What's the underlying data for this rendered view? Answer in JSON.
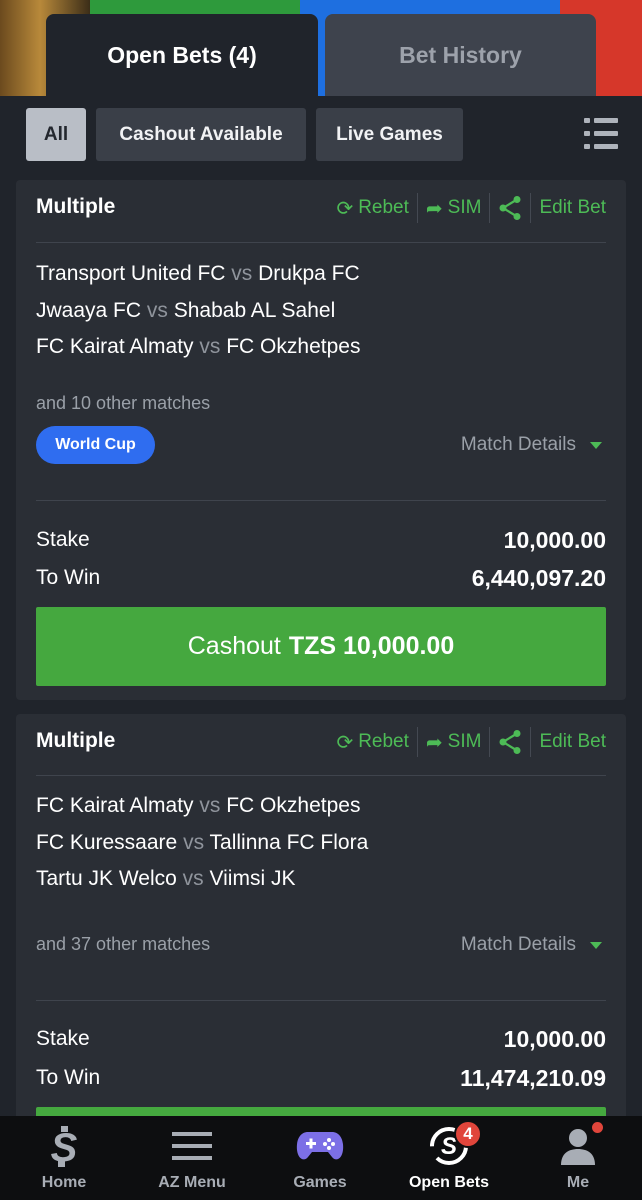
{
  "tabs": {
    "open_bets": "Open Bets (4)",
    "bet_history": "Bet History"
  },
  "filters": {
    "all": "All",
    "cashout_available": "Cashout Available",
    "live_games": "Live Games"
  },
  "colors": {
    "accent_green": "#4dbb56",
    "cashout_green": "#45a83f",
    "badge_blue": "#2f6df0",
    "notification_red": "#e0453b"
  },
  "bets": [
    {
      "type": "Multiple",
      "actions": {
        "rebet": "Rebet",
        "sim": "SIM",
        "edit": "Edit Bet"
      },
      "matches": [
        {
          "home": "Transport United FC",
          "vs": "vs",
          "away": "Drukpa FC"
        },
        {
          "home": "Jwaaya FC",
          "vs": "vs",
          "away": "Shabab AL Sahel"
        },
        {
          "home": "FC Kairat Almaty",
          "vs": "vs",
          "away": "FC Okzhetpes"
        }
      ],
      "more_matches": "and 10 other matches",
      "badge": "World Cup",
      "match_details": "Match Details",
      "stake_label": "Stake",
      "stake": "10,000.00",
      "to_win_label": "To Win",
      "to_win": "6,440,097.20",
      "cashout_label": "Cashout",
      "cashout_amount": "TZS 10,000.00"
    },
    {
      "type": "Multiple",
      "actions": {
        "rebet": "Rebet",
        "sim": "SIM",
        "edit": "Edit Bet"
      },
      "matches": [
        {
          "home": "FC Kairat Almaty",
          "vs": "vs",
          "away": "FC Okzhetpes"
        },
        {
          "home": "FC Kuressaare",
          "vs": "vs",
          "away": "Tallinna FC Flora"
        },
        {
          "home": "Tartu JK Welco",
          "vs": "vs",
          "away": "Viimsi JK"
        }
      ],
      "more_matches": "and 37 other matches",
      "match_details": "Match Details",
      "stake_label": "Stake",
      "stake": "10,000.00",
      "to_win_label": "To Win",
      "to_win": "11,474,210.09"
    }
  ],
  "nav": {
    "home": "Home",
    "az_menu": "AZ Menu",
    "games": "Games",
    "open_bets": "Open Bets",
    "open_bets_count": "4",
    "me": "Me"
  }
}
